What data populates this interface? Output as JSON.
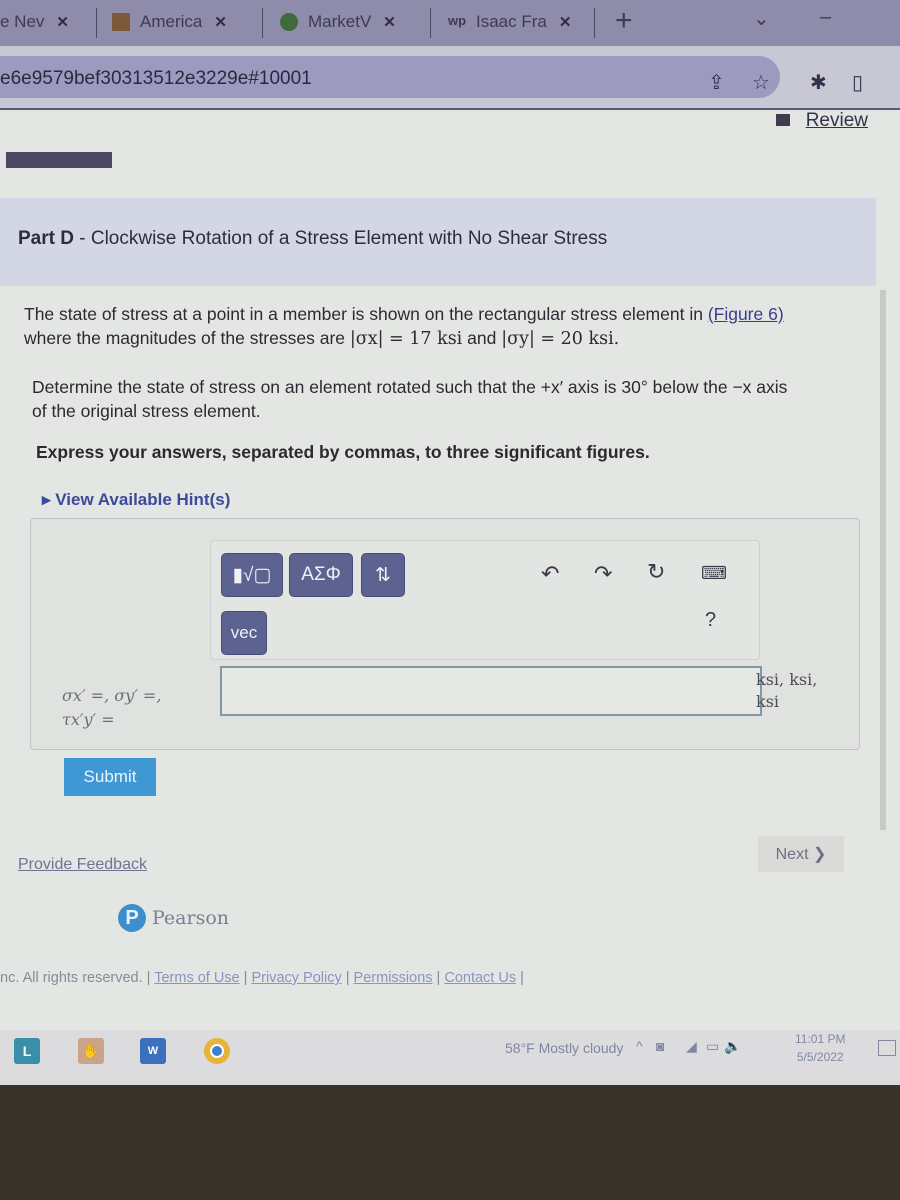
{
  "browser": {
    "tabs": [
      {
        "label": "e Nev",
        "icon": "news-icon"
      },
      {
        "label": "America",
        "icon": "calculator-icon"
      },
      {
        "label": "MarketV",
        "icon": "marketwatch-icon"
      },
      {
        "label": "Isaac Fra",
        "icon": "wattpad-icon"
      }
    ],
    "new_tab": "+",
    "url": "e6e9579bef30313512e3229e#10001"
  },
  "page": {
    "review_link": "Review",
    "part_title_bold": "Part D",
    "part_title_rest": " - Clockwise Rotation of a Stress Element with No Shear Stress",
    "problem": {
      "line1_pre": "The state of stress at a point in a member is shown on the rectangular stress element in ",
      "figure_link": "(Figure 6)",
      "line2_pre": "where the magnitudes of the stresses are ",
      "sigma_x": "|σx| = 17 ksi",
      "and": " and ",
      "sigma_y": "|σy| = 20 ksi."
    },
    "instruction": {
      "line1": "Determine the state of stress on an element rotated such that the +x′ axis is 30° below the −x axis",
      "line2": "of the original stress element."
    },
    "express": "Express your answers, separated by commas, to three significant figures.",
    "hint": "View Available Hint(s)",
    "toolbar": {
      "templates": "▮√▢",
      "greek": "ΑΣΦ",
      "arrows": "⇅",
      "vec": "vec",
      "help": "?"
    },
    "answer": {
      "label_line1": "σx′ =, σy′ =,",
      "label_line2": "τx′y′ =",
      "value": "",
      "units_line1": "ksi, ksi,",
      "units_line2": "ksi"
    },
    "submit": "Submit",
    "feedback": "Provide Feedback",
    "next": "Next ❯",
    "pearson": "Pearson",
    "footer": {
      "text": "nc. All rights reserved. | ",
      "links": [
        "Terms of Use",
        "Privacy Policy",
        "Permissions",
        "Contact Us"
      ]
    }
  },
  "taskbar": {
    "weather": "58°F  Mostly cloudy",
    "time": "11:01 PM",
    "date": "5/5/2022"
  }
}
